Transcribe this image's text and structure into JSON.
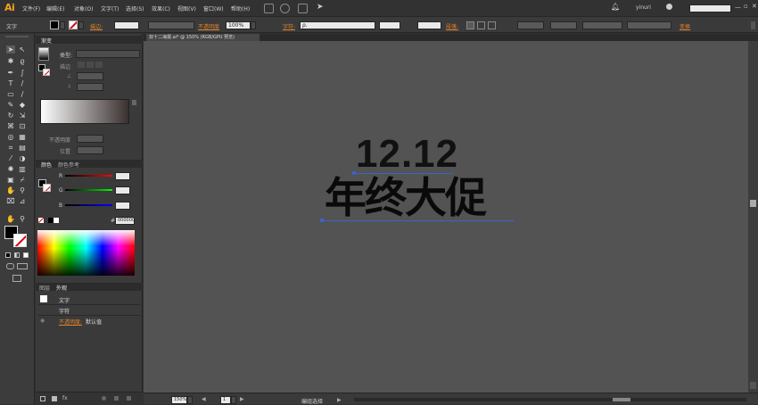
{
  "app": {
    "logo": "Ai"
  },
  "menu": [
    "文件(F)",
    "编辑(E)",
    "对象(O)",
    "文字(T)",
    "选择(S)",
    "效果(C)",
    "视图(V)",
    "窗口(W)",
    "帮助(H)"
  ],
  "topbar": {
    "user": "yinuri",
    "search_placeholder": ""
  },
  "control": {
    "type_label": "文字",
    "stroke_label": "描边:",
    "opacity_label": "不透明度",
    "opacity_value": "100%",
    "char_label": "字符:",
    "font_placeholder": "ρ.",
    "para_label": "段落:",
    "transform_label": "变换"
  },
  "gradient_panel": {
    "tab": "渐变",
    "type_label": "类型:",
    "stroke_label": "描边",
    "opacity_label": "不透明度",
    "position_label": "位置"
  },
  "color_panel": {
    "tab_active": "颜色",
    "tab_other": "颜色参考",
    "r_label": "R",
    "g_label": "G",
    "b_label": "B",
    "hash": "#",
    "hex_value": "000000"
  },
  "appearance_panel": {
    "tab_other": "图层",
    "tab_active": "外观",
    "row1": "文字",
    "row2": "字符",
    "opacity_link": "不透明度:",
    "opacity_value": "默认值"
  },
  "document": {
    "tab_title": "双十二海报.ai* @ 150% (RGB/GPU 预览)",
    "headline_number": "12.12",
    "headline_text": "年终大促"
  },
  "status": {
    "zoom": "150%",
    "page": "1",
    "mode": "编组选择"
  },
  "colors": {
    "accent": "#e0832a",
    "canvas": "#535353",
    "guide": "#3d63c9"
  }
}
